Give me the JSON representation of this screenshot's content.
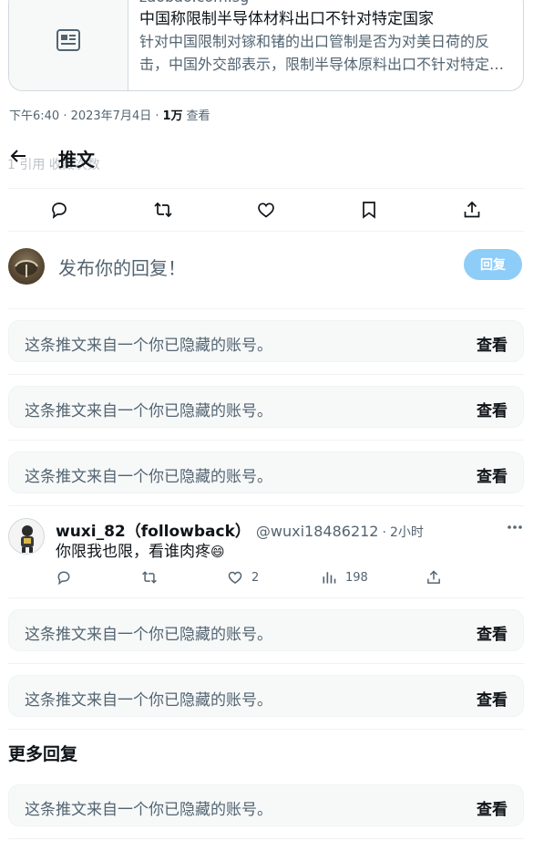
{
  "link_card": {
    "domain": "zaobao.com.sg",
    "title": "中国称限制半导体材料出口不针对特定国家",
    "description": "针对中国限制对镓和锗的出口管制是否为对美日荷的反击，中国外交部表示，限制半导体原料出口不针对特定国家",
    "thumb_icon": "article-icon"
  },
  "timestamp": {
    "time_text": "下午6:40 · 2023年7月4日 ·",
    "views_count": "1万",
    "views_label": "查看"
  },
  "faded_stats": "1 引用   收藏次数",
  "header": {
    "back_icon": "arrow-left-icon",
    "title": "推文"
  },
  "actions": [
    {
      "name": "reply-icon"
    },
    {
      "name": "retweet-icon"
    },
    {
      "name": "like-icon"
    },
    {
      "name": "bookmark-icon"
    },
    {
      "name": "share-icon"
    }
  ],
  "reply_composer": {
    "placeholder": "发布你的回复！",
    "button_label": "回复",
    "button_color": "#8ecdf8"
  },
  "hidden_notices": [
    {
      "text": "这条推文来自一个你已隐藏的账号。",
      "action": "查看"
    },
    {
      "text": "这条推文来自一个你已隐藏的账号。",
      "action": "查看"
    },
    {
      "text": "这条推文来自一个你已隐藏的账号。",
      "action": "查看"
    },
    {
      "text": "这条推文来自一个你已隐藏的账号。",
      "action": "查看"
    },
    {
      "text": "这条推文来自一个你已隐藏的账号。",
      "action": "查看"
    },
    {
      "text": "这条推文来自一个你已隐藏的账号。",
      "action": "查看"
    }
  ],
  "tweet": {
    "name": "wuxi_82（followback）",
    "handle": "@wuxi18486212",
    "separator": "·",
    "time": "2小时",
    "text": "你限我也限，看谁肉疼",
    "emoji": "😄",
    "replies": "",
    "retweets": "",
    "likes": "2",
    "views": "198"
  },
  "more_replies_title": "更多回复",
  "colors": {
    "text": "#0f1419",
    "secondary": "#536471",
    "border": "#cfd9de",
    "panel": "#f7f9f9",
    "accent": "#1d9bf0"
  }
}
